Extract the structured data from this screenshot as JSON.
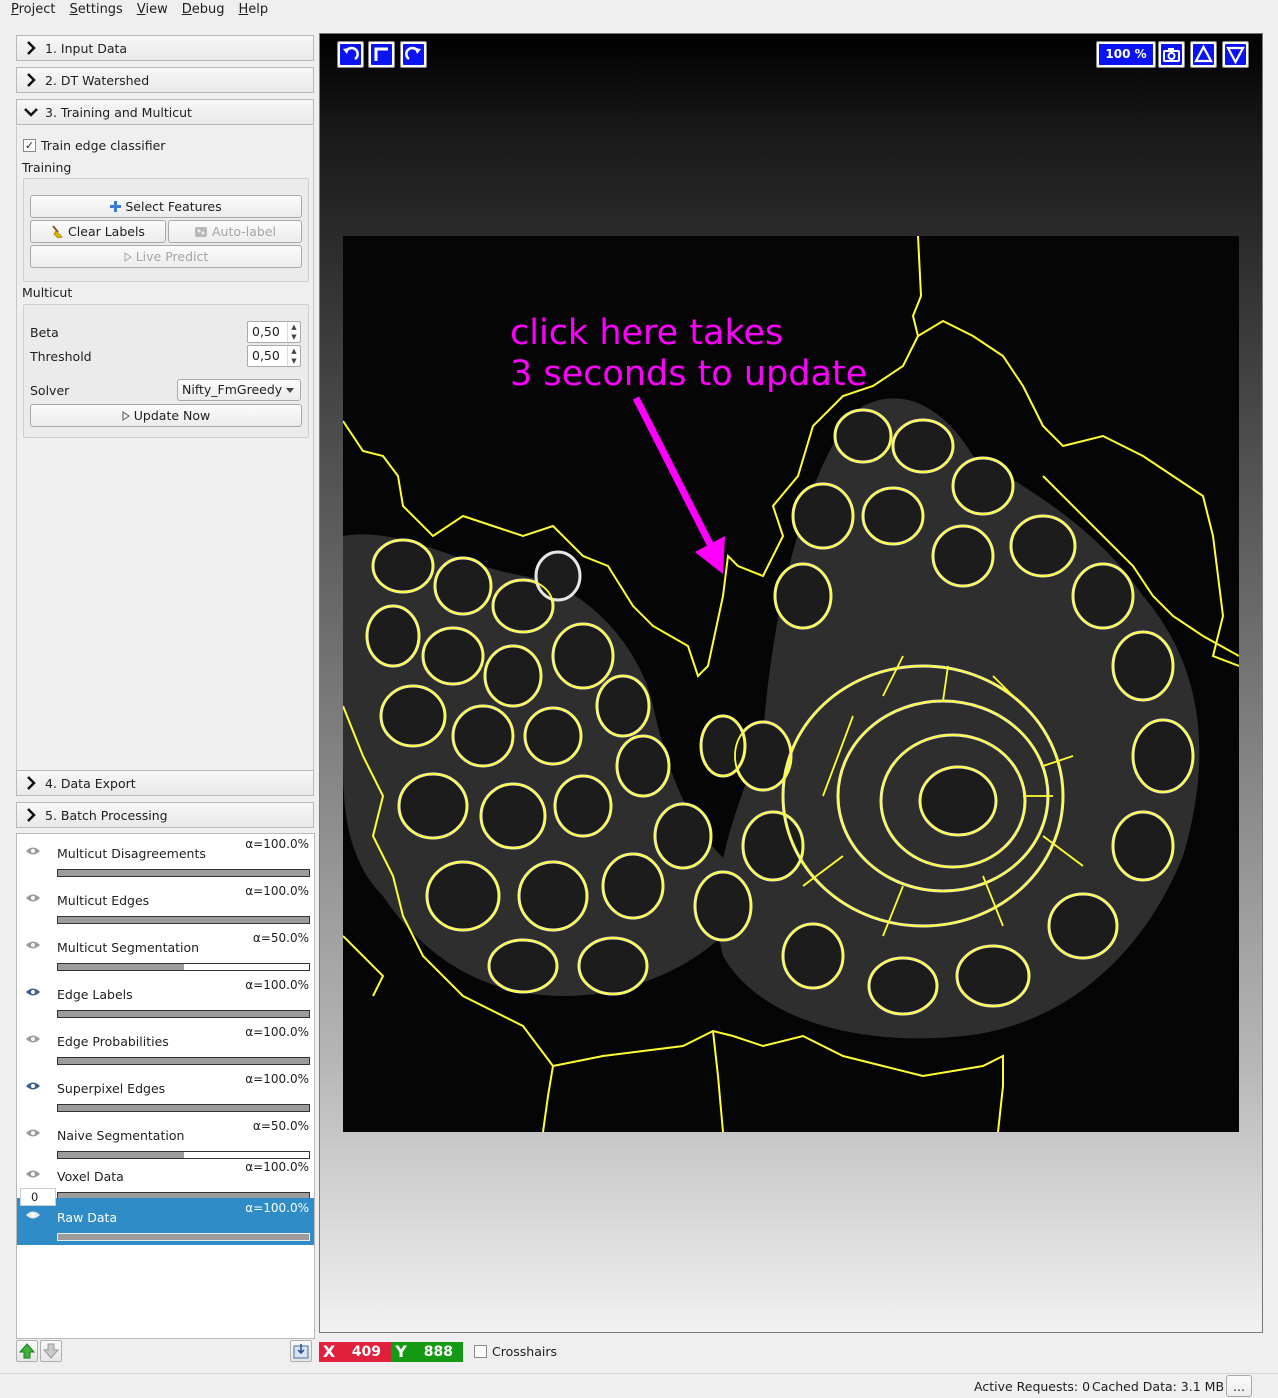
{
  "menu": [
    "Project",
    "Settings",
    "View",
    "Debug",
    "Help"
  ],
  "applets": {
    "input_data": "1. Input Data",
    "dt_watershed": "2. DT Watershed",
    "training_multicut": "3. Training and Multicut",
    "data_export": "4. Data Export",
    "batch_processing": "5. Batch Processing"
  },
  "training": {
    "train_checkbox_label": "Train edge classifier",
    "train_checked": "✓",
    "section_label": "Training",
    "select_features": "Select Features",
    "clear_labels": "Clear Labels",
    "auto_label": "Auto-label",
    "live_predict": "Live Predict"
  },
  "multicut": {
    "section_label": "Multicut",
    "beta_label": "Beta",
    "beta_value": "0,50",
    "threshold_label": "Threshold",
    "threshold_value": "0,50",
    "solver_label": "Solver",
    "solver_value": "Nifty_FmGreedy",
    "update_now": "Update Now"
  },
  "layers": [
    {
      "name": "Multicut Disagreements",
      "alpha": "α=100.0%",
      "opacity": 1.0,
      "visible": false
    },
    {
      "name": "Multicut Edges",
      "alpha": "α=100.0%",
      "opacity": 1.0,
      "visible": false
    },
    {
      "name": "Multicut Segmentation",
      "alpha": "α=50.0%",
      "opacity": 0.5,
      "visible": false
    },
    {
      "name": "Edge Labels",
      "alpha": "α=100.0%",
      "opacity": 1.0,
      "visible": true
    },
    {
      "name": "Edge Probabilities",
      "alpha": "α=100.0%",
      "opacity": 1.0,
      "visible": false
    },
    {
      "name": "Superpixel Edges",
      "alpha": "α=100.0%",
      "opacity": 1.0,
      "visible": true
    },
    {
      "name": "Naive Segmentation",
      "alpha": "α=50.0%",
      "opacity": 0.5,
      "visible": false
    },
    {
      "name": "Voxel Data",
      "alpha": "α=100.0%",
      "opacity": 1.0,
      "visible": false
    },
    {
      "name": "Raw Data",
      "alpha": "α=100.0%",
      "opacity": 1.0,
      "visible": true,
      "selected": true
    }
  ],
  "voxel_channel": "0",
  "viewer": {
    "zoom": "100 %",
    "annotation_line1": "click here takes",
    "annotation_line2": "3 seconds to update",
    "annotation_color": "#ff00ff",
    "edge_color": "#ffff33"
  },
  "position": {
    "x_label": "X",
    "x_value": "409",
    "y_label": "Y",
    "y_value": "888"
  },
  "crosshairs_label": "Crosshairs",
  "status": {
    "active_requests": "Active Requests: 0",
    "cached_data": "Cached Data: 3.1 MB",
    "more_button": "..."
  },
  "colors": {
    "x_badge": "#e0203c",
    "y_badge": "#149a14",
    "selection": "#308cc6",
    "viewer_button": "#0a14f0"
  }
}
